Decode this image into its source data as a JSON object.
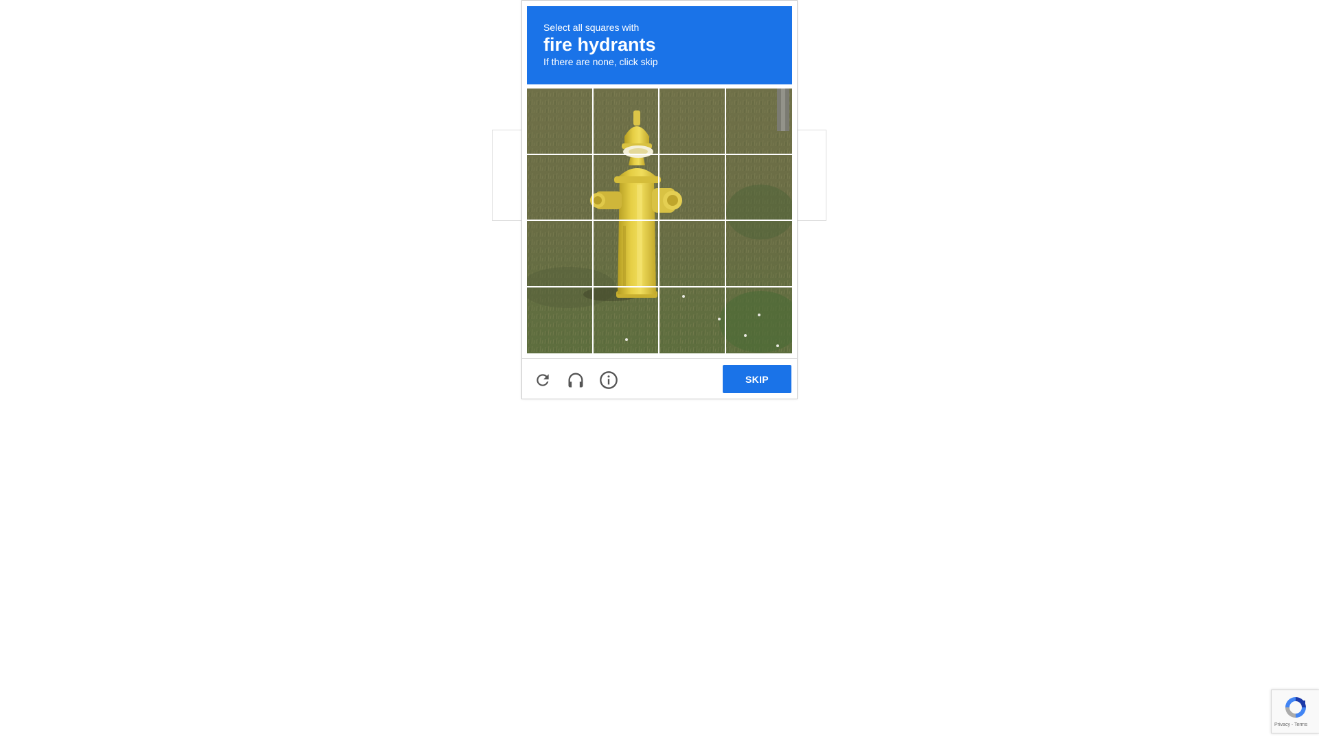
{
  "challenge": {
    "prompt_line1": "Select all squares with",
    "prompt_target": "fire hydrants",
    "prompt_line3": "If there are none, click skip",
    "accent_color": "#1a73e8",
    "grid_size": "4x4",
    "skip_label": "SKIP",
    "controls": [
      {
        "icon": "reload-icon"
      },
      {
        "icon": "headphones-icon"
      },
      {
        "icon": "info-icon"
      }
    ]
  },
  "badge": {
    "links": "Privacy - Terms",
    "icon": "recaptcha-logo-icon"
  }
}
